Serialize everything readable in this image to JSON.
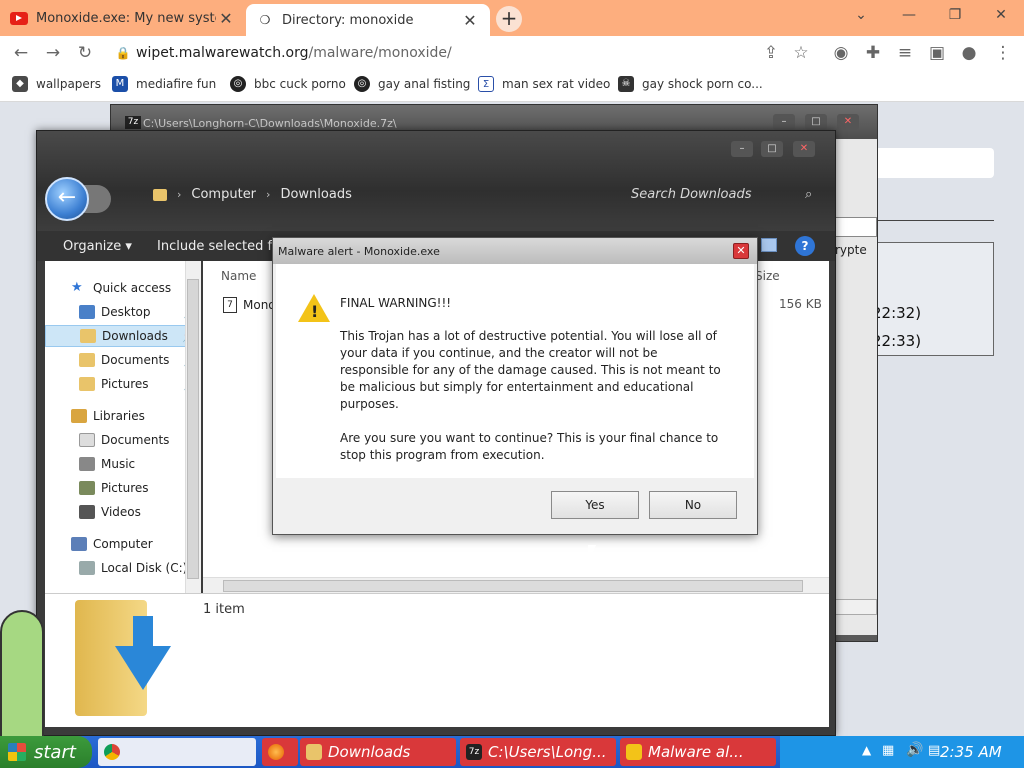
{
  "browser": {
    "tabs": [
      {
        "title": "Monoxide.exe: My new system",
        "active": false,
        "icon": "youtube-icon"
      },
      {
        "title": "Directory: monoxide",
        "active": true,
        "icon": "page-icon"
      }
    ],
    "url_host": "wipet.malwarewatch.org",
    "url_path": "/malware/monoxide/",
    "bookmarks": [
      {
        "label": "wallpapers"
      },
      {
        "label": "mediafire fun"
      },
      {
        "label": "bbc cuck porno"
      },
      {
        "label": "gay anal fisting"
      },
      {
        "label": "man sex rat video"
      },
      {
        "label": "gay shock porn co..."
      }
    ]
  },
  "page": {
    "times": [
      "22:32)",
      "22:33)"
    ],
    "partial_label": "rypte"
  },
  "sevenzip": {
    "title": "C:\\Users\\Longhorn-C\\Downloads\\Monoxide.7z\\"
  },
  "explorer": {
    "breadcrumbs": [
      "Computer",
      "Downloads"
    ],
    "search_placeholder": "Search Downloads",
    "commands": {
      "organize": "Organize ▾",
      "include": "Include selected fold"
    },
    "nav": {
      "quick_access": "Quick access",
      "desktop": "Desktop",
      "downloads": "Downloads",
      "documents": "Documents",
      "pictures": "Pictures",
      "libraries": "Libraries",
      "lib_documents": "Documents",
      "music": "Music",
      "lib_pictures": "Pictures",
      "videos": "Videos",
      "computer": "Computer",
      "local_disk": "Local Disk (C:)"
    },
    "columns": {
      "name": "Name",
      "size": "Size"
    },
    "file": {
      "name": "Mono",
      "size": "156 KB"
    },
    "item_count": "1 item"
  },
  "dialog": {
    "title": "Malware alert - Monoxide.exe",
    "heading": "FINAL WARNING!!!",
    "message": "This Trojan has a lot of destructive potential. You will lose all of your data if you continue, and the creator will not be responsible for any of the damage caused. This is not meant to be malicious but simply for entertainment and educational purposes.",
    "question": "Are you sure you want to continue? This is your final chance to stop this program from execution.",
    "yes": "Yes",
    "no": "No"
  },
  "taskbar": {
    "start": "start",
    "tasks": [
      {
        "label": "",
        "icon": "chrome-icon"
      },
      {
        "label": "",
        "icon": "firefox-icon"
      },
      {
        "label": "Downloads",
        "icon": "folder-icon"
      },
      {
        "label": "C:\\Users\\Long...",
        "icon": "7zip-icon"
      },
      {
        "label": "Malware al...",
        "icon": "alert-icon"
      }
    ],
    "clock": "2:35 AM"
  },
  "colors": {
    "tabstrip": "#fdae7e",
    "taskbar": "#1c57c4",
    "start": "#2b7f2b",
    "task_red": "#d9383a"
  }
}
